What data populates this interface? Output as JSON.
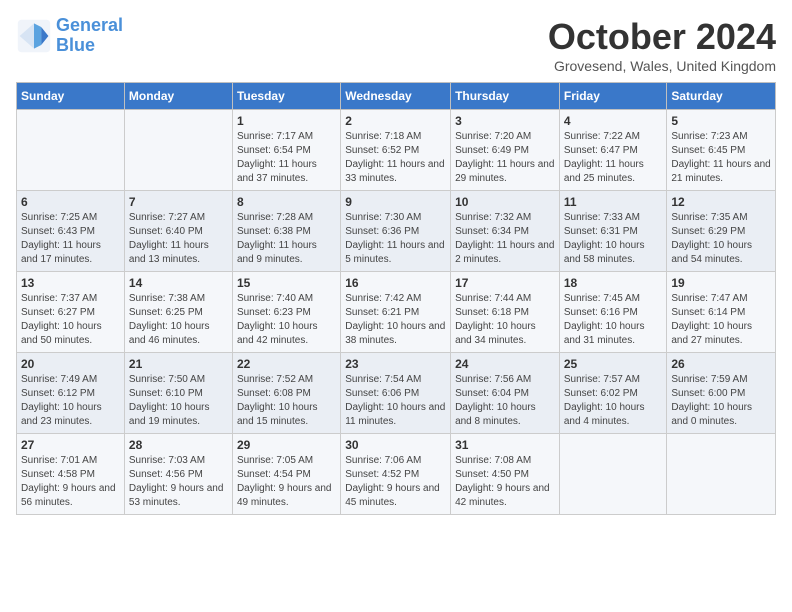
{
  "logo": {
    "line1": "General",
    "line2": "Blue"
  },
  "title": "October 2024",
  "subtitle": "Grovesend, Wales, United Kingdom",
  "days_of_week": [
    "Sunday",
    "Monday",
    "Tuesday",
    "Wednesday",
    "Thursday",
    "Friday",
    "Saturday"
  ],
  "weeks": [
    [
      {
        "day": "",
        "content": ""
      },
      {
        "day": "",
        "content": ""
      },
      {
        "day": "1",
        "content": "Sunrise: 7:17 AM\nSunset: 6:54 PM\nDaylight: 11 hours and 37 minutes."
      },
      {
        "day": "2",
        "content": "Sunrise: 7:18 AM\nSunset: 6:52 PM\nDaylight: 11 hours and 33 minutes."
      },
      {
        "day": "3",
        "content": "Sunrise: 7:20 AM\nSunset: 6:49 PM\nDaylight: 11 hours and 29 minutes."
      },
      {
        "day": "4",
        "content": "Sunrise: 7:22 AM\nSunset: 6:47 PM\nDaylight: 11 hours and 25 minutes."
      },
      {
        "day": "5",
        "content": "Sunrise: 7:23 AM\nSunset: 6:45 PM\nDaylight: 11 hours and 21 minutes."
      }
    ],
    [
      {
        "day": "6",
        "content": "Sunrise: 7:25 AM\nSunset: 6:43 PM\nDaylight: 11 hours and 17 minutes."
      },
      {
        "day": "7",
        "content": "Sunrise: 7:27 AM\nSunset: 6:40 PM\nDaylight: 11 hours and 13 minutes."
      },
      {
        "day": "8",
        "content": "Sunrise: 7:28 AM\nSunset: 6:38 PM\nDaylight: 11 hours and 9 minutes."
      },
      {
        "day": "9",
        "content": "Sunrise: 7:30 AM\nSunset: 6:36 PM\nDaylight: 11 hours and 5 minutes."
      },
      {
        "day": "10",
        "content": "Sunrise: 7:32 AM\nSunset: 6:34 PM\nDaylight: 11 hours and 2 minutes."
      },
      {
        "day": "11",
        "content": "Sunrise: 7:33 AM\nSunset: 6:31 PM\nDaylight: 10 hours and 58 minutes."
      },
      {
        "day": "12",
        "content": "Sunrise: 7:35 AM\nSunset: 6:29 PM\nDaylight: 10 hours and 54 minutes."
      }
    ],
    [
      {
        "day": "13",
        "content": "Sunrise: 7:37 AM\nSunset: 6:27 PM\nDaylight: 10 hours and 50 minutes."
      },
      {
        "day": "14",
        "content": "Sunrise: 7:38 AM\nSunset: 6:25 PM\nDaylight: 10 hours and 46 minutes."
      },
      {
        "day": "15",
        "content": "Sunrise: 7:40 AM\nSunset: 6:23 PM\nDaylight: 10 hours and 42 minutes."
      },
      {
        "day": "16",
        "content": "Sunrise: 7:42 AM\nSunset: 6:21 PM\nDaylight: 10 hours and 38 minutes."
      },
      {
        "day": "17",
        "content": "Sunrise: 7:44 AM\nSunset: 6:18 PM\nDaylight: 10 hours and 34 minutes."
      },
      {
        "day": "18",
        "content": "Sunrise: 7:45 AM\nSunset: 6:16 PM\nDaylight: 10 hours and 31 minutes."
      },
      {
        "day": "19",
        "content": "Sunrise: 7:47 AM\nSunset: 6:14 PM\nDaylight: 10 hours and 27 minutes."
      }
    ],
    [
      {
        "day": "20",
        "content": "Sunrise: 7:49 AM\nSunset: 6:12 PM\nDaylight: 10 hours and 23 minutes."
      },
      {
        "day": "21",
        "content": "Sunrise: 7:50 AM\nSunset: 6:10 PM\nDaylight: 10 hours and 19 minutes."
      },
      {
        "day": "22",
        "content": "Sunrise: 7:52 AM\nSunset: 6:08 PM\nDaylight: 10 hours and 15 minutes."
      },
      {
        "day": "23",
        "content": "Sunrise: 7:54 AM\nSunset: 6:06 PM\nDaylight: 10 hours and 11 minutes."
      },
      {
        "day": "24",
        "content": "Sunrise: 7:56 AM\nSunset: 6:04 PM\nDaylight: 10 hours and 8 minutes."
      },
      {
        "day": "25",
        "content": "Sunrise: 7:57 AM\nSunset: 6:02 PM\nDaylight: 10 hours and 4 minutes."
      },
      {
        "day": "26",
        "content": "Sunrise: 7:59 AM\nSunset: 6:00 PM\nDaylight: 10 hours and 0 minutes."
      }
    ],
    [
      {
        "day": "27",
        "content": "Sunrise: 7:01 AM\nSunset: 4:58 PM\nDaylight: 9 hours and 56 minutes."
      },
      {
        "day": "28",
        "content": "Sunrise: 7:03 AM\nSunset: 4:56 PM\nDaylight: 9 hours and 53 minutes."
      },
      {
        "day": "29",
        "content": "Sunrise: 7:05 AM\nSunset: 4:54 PM\nDaylight: 9 hours and 49 minutes."
      },
      {
        "day": "30",
        "content": "Sunrise: 7:06 AM\nSunset: 4:52 PM\nDaylight: 9 hours and 45 minutes."
      },
      {
        "day": "31",
        "content": "Sunrise: 7:08 AM\nSunset: 4:50 PM\nDaylight: 9 hours and 42 minutes."
      },
      {
        "day": "",
        "content": ""
      },
      {
        "day": "",
        "content": ""
      }
    ]
  ]
}
